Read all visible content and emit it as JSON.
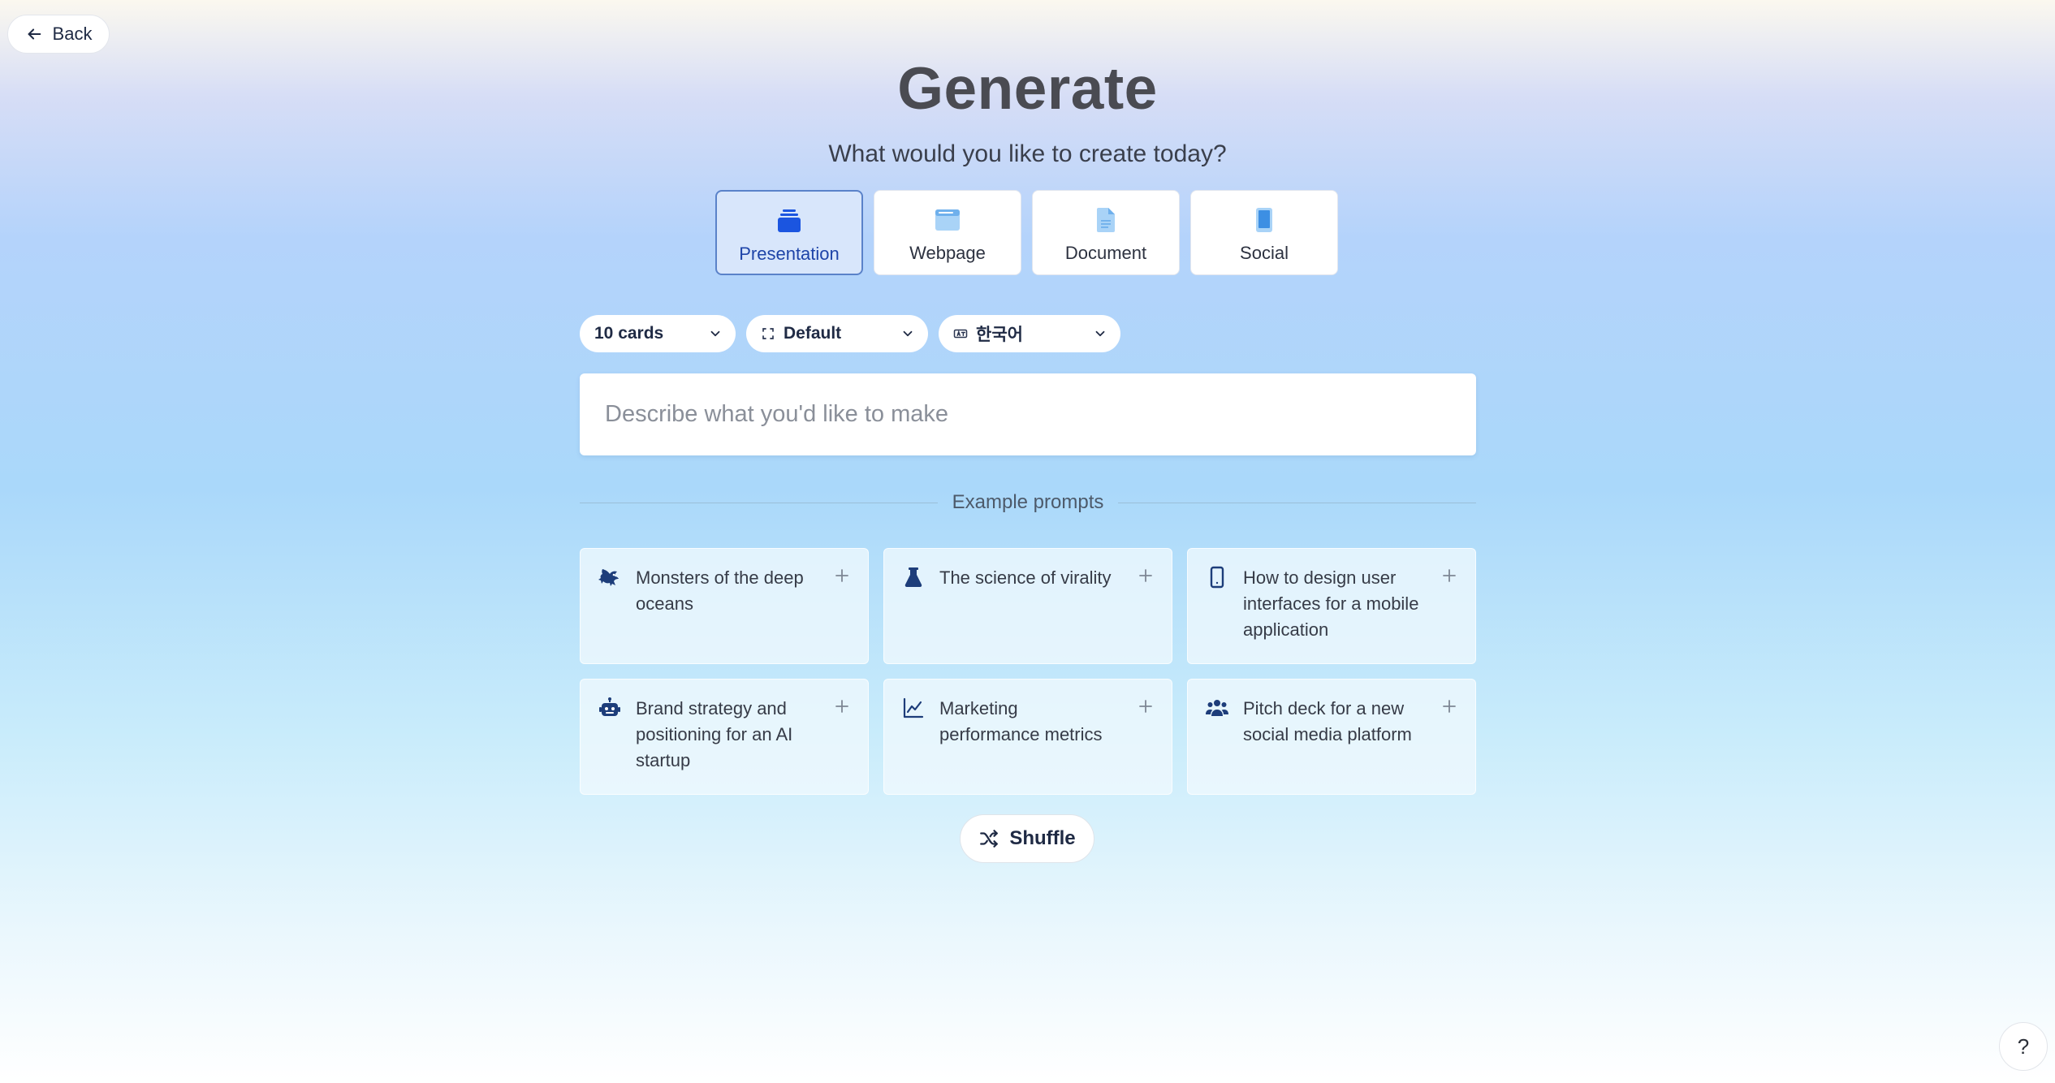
{
  "back": {
    "label": "Back"
  },
  "header": {
    "title": "Generate",
    "subtitle": "What would you like to create today?"
  },
  "types": [
    {
      "label": "Presentation",
      "icon": "stacked-cards-icon",
      "selected": true
    },
    {
      "label": "Webpage",
      "icon": "browser-window-icon",
      "selected": false
    },
    {
      "label": "Document",
      "icon": "document-icon",
      "selected": false
    },
    {
      "label": "Social",
      "icon": "phone-icon",
      "selected": false
    }
  ],
  "options": {
    "cards": "10 cards",
    "format": "Default",
    "language": "한국어"
  },
  "prompt": {
    "placeholder": "Describe what you'd like to make",
    "value": ""
  },
  "examples": {
    "heading": "Example prompts",
    "items": [
      {
        "text": "Monsters of the deep oceans",
        "icon": "sea-monster-icon"
      },
      {
        "text": "The science of virality",
        "icon": "flask-icon"
      },
      {
        "text": "How to design user interfaces for a mobile application",
        "icon": "mobile-icon"
      },
      {
        "text": "Brand strategy and positioning for an AI startup",
        "icon": "robot-icon"
      },
      {
        "text": "Marketing performance metrics",
        "icon": "line-chart-icon"
      },
      {
        "text": "Pitch deck for a new social media platform",
        "icon": "users-icon"
      }
    ]
  },
  "shuffle": {
    "label": "Shuffle"
  },
  "help": {
    "label": "?"
  },
  "colors": {
    "accent": "#1e44a8",
    "selected_bg": "#d8e6fb",
    "icon_light": "#8fc3f2",
    "icon_dark": "#1d3d7a"
  }
}
